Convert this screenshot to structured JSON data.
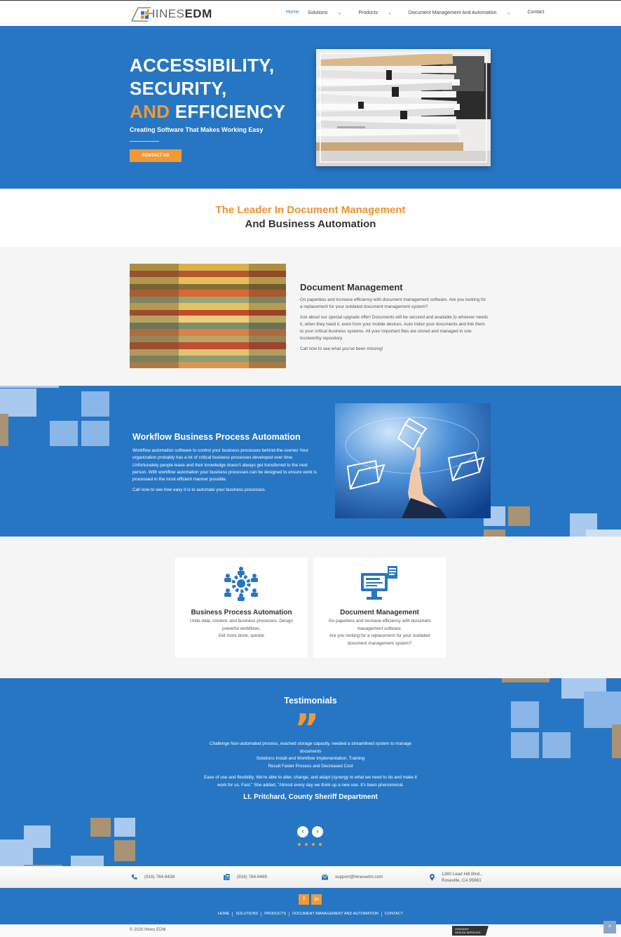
{
  "header": {
    "logo_text_light": "HINES",
    "logo_text_bold": "EDM",
    "nav": [
      {
        "label": "Home",
        "active": true,
        "dropdown": false
      },
      {
        "label": "Solutions",
        "active": false,
        "dropdown": true
      },
      {
        "label": "Products",
        "active": false,
        "dropdown": true
      },
      {
        "label": "Document Management And Automation",
        "active": false,
        "dropdown": true
      },
      {
        "label": "Contact",
        "active": false,
        "dropdown": false
      }
    ],
    "chevron": "❯"
  },
  "hero": {
    "line1": "ACCESSIBILITY,",
    "line2": "SECURITY,",
    "line3_orange": "AND",
    "line3_white": " EFFICIENCY",
    "subtitle": "Creating Software That Makes Working Easy",
    "button": "CONTACT US"
  },
  "leader": {
    "line1": "The Leader In Document Management",
    "line2": "And Business Automation"
  },
  "document_management": {
    "title": "Document Management",
    "paragraphs": [
      "Go paperless and increase efficiency with document management software. Are you looking for a replacement for your outdated document management system?",
      "Ask about our special upgrade offer! Documents will be secured and available to whoever needs it, when they need it, even from your mobile devices. Auto Index your documents and link them to your critical business systems. All your important files are stored and managed in one trustworthy repository.",
      "Call now to see what you've been missing!"
    ]
  },
  "workflow": {
    "title": "Workflow Business Process Automation",
    "paragraphs": [
      "Workflow automation software to control your business processes behind-the-scenes Your organization probably has a lot of critical business processes developed over time. Unfortunately people leave and their knowledge doesn't always get transferred to the next person. With workflow automation your business processes can be designed to ensure work is processed in the most efficient manner possible.",
      "Call now to see how easy it is to automate your business processes."
    ]
  },
  "cards": [
    {
      "icon": "team-gear-icon",
      "title": "Business Process Automation",
      "lines": [
        "Unite data, content, and business processes. Design powerful workflows.",
        "Get more done, quicker"
      ]
    },
    {
      "icon": "computer-document-icon",
      "title": "Document Management",
      "lines": [
        "Go paperless and increase efficiency with document management software.",
        "Are you looking for a replacement for your outdated document management system?"
      ]
    }
  ],
  "testimonials": {
    "title": "Testimonials",
    "quote_glyph": "”",
    "paragraphs": [
      "Challenge Non-automated process, reached storage capacity, needed a streamlined system to manage documents",
      "Solutions Install and Workflow Implementation, Training",
      "Result Faster Process and Decreased Cost",
      "Ease of use and flexibility. We're able to alter, change, and adapt (synergy to what we need to do and make it work for us. Fast.\" She added, \"Almost every day we think up a new use. It's been phenomenal."
    ],
    "author": "Lt. Pritchard, County Sheriff Department",
    "prev": "‹",
    "next": "›",
    "slides": 4
  },
  "contact": {
    "phone": "(916) 784-8436",
    "fax": "(916) 784-9489",
    "email": "support@hinesedm.com",
    "address_line1": "1380 Lead Hill Blvd.,",
    "address_line2": "Roseville, CA 95661"
  },
  "footer": {
    "social": [
      "f",
      "in"
    ],
    "nav": [
      "HOME",
      "SOLUTIONS",
      "PRODUCTS",
      "DOCUMENT MANAGEMENT AND AUTOMATION",
      "CONTACT"
    ],
    "copyright": "© 2020 Hines EDM",
    "badge_line1": "GODADDY",
    "badge_line2": "DESIGN SERVICES",
    "to_top": "^"
  },
  "colors": {
    "primary_blue": "#2776c4",
    "accent_orange": "#f19a35",
    "light_gray": "#f5f5f5"
  }
}
